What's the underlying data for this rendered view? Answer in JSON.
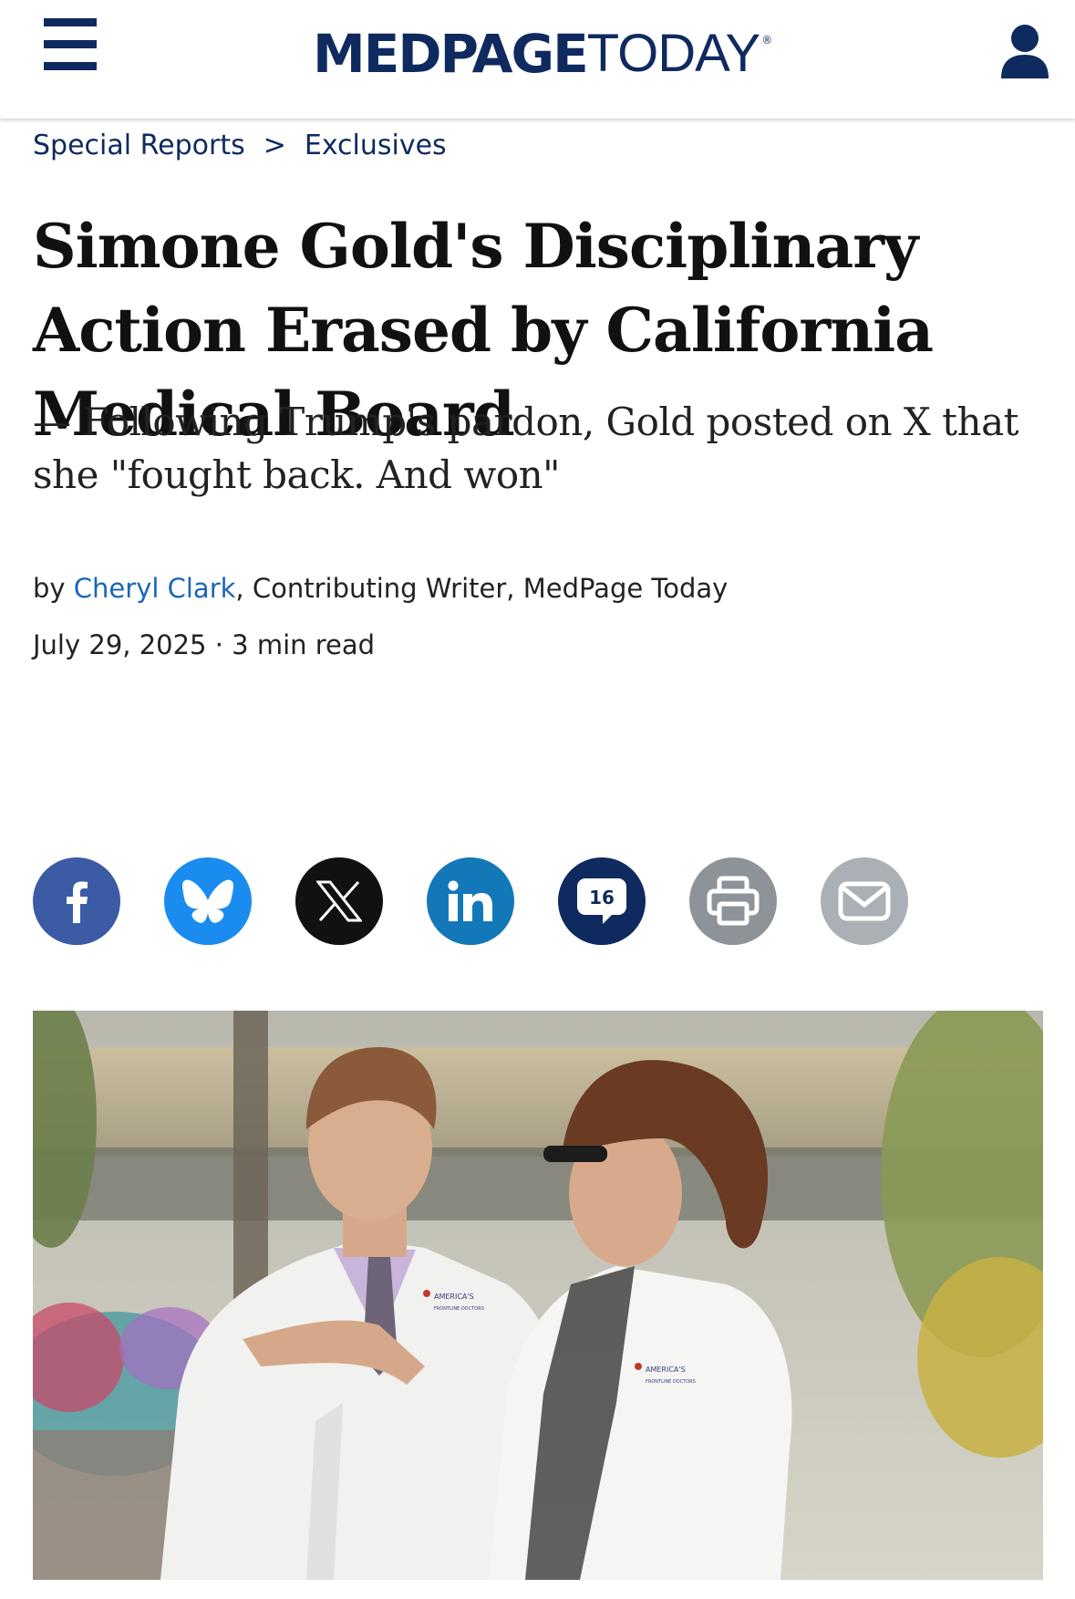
{
  "header": {
    "menu_icon": "hamburger-menu-icon",
    "logo": {
      "part1": "MEDPAGE",
      "part2": "TODAY",
      "registered": "®",
      "color": "#0f2a5f"
    },
    "account_icon": "user-account-icon"
  },
  "breadcrumb": {
    "items": [
      {
        "label": "Special Reports"
      },
      {
        "label": "Exclusives"
      }
    ],
    "separator": ">"
  },
  "article": {
    "title": "Simone Gold's Disciplinary Action Erased by California Medical Board",
    "subtitle": "— Following Trump's pardon, Gold posted on X that she \"fought back. And won\"",
    "byline": {
      "prefix": "by ",
      "author": "Cheryl Clark",
      "suffix": ", Contributing Writer, MedPage Today"
    },
    "date": "July 29, 2025",
    "date_sep": " · ",
    "read_time": "3 min read"
  },
  "share": {
    "buttons": [
      {
        "name": "facebook",
        "icon": "facebook-icon",
        "color": "#3b5ba5"
      },
      {
        "name": "bluesky",
        "icon": "bluesky-butterfly-icon",
        "color": "#1a8cf0"
      },
      {
        "name": "x",
        "icon": "x-logo-icon",
        "color": "#111111"
      },
      {
        "name": "linkedin",
        "icon": "linkedin-icon",
        "color": "#1378b8"
      },
      {
        "name": "comments",
        "icon": "comment-bubble-icon",
        "count": "16",
        "color": "#0f2a5f"
      },
      {
        "name": "print",
        "icon": "printer-icon",
        "color": "#8d9398"
      },
      {
        "name": "email",
        "icon": "envelope-icon",
        "color": "#aab0b5"
      }
    ]
  },
  "photo": {
    "coat_logo_text": "AMERICA'S",
    "coat_logo_text2": "FRONTLINE DOCTORS"
  }
}
